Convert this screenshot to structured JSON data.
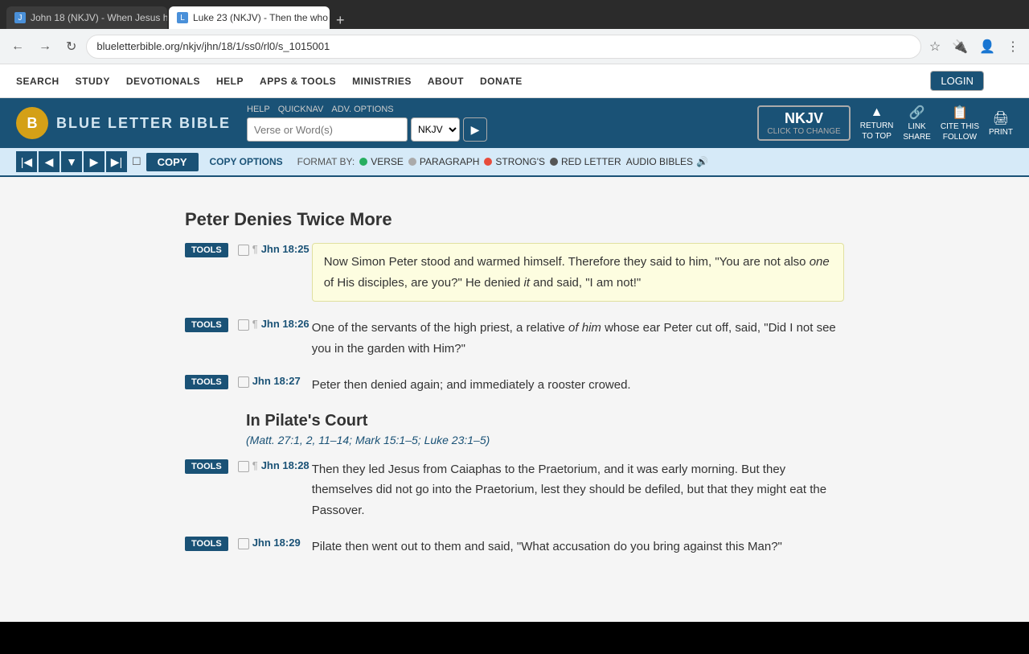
{
  "browser": {
    "tabs": [
      {
        "id": "tab1",
        "label": "John 18 (NKJV) - When Jesus h",
        "active": false,
        "favicon": "J"
      },
      {
        "id": "tab2",
        "label": "Luke 23 (NKJV) - Then the who",
        "active": true,
        "favicon": "L"
      }
    ],
    "url": "blueletterbible.org/nkjv/jhn/18/1/ss0/rl0/s_1015001",
    "new_tab_label": "+"
  },
  "nav": {
    "back": "←",
    "forward": "→",
    "reload": "↻"
  },
  "site": {
    "logo_letter": "B",
    "logo_text": "Blue Letter Bible",
    "search_placeholder": "Verse or Word(s)",
    "version": "NKJV",
    "version_click": "CLICK TO CHANGE",
    "nav_items": [
      "SEARCH",
      "STUDY",
      "DEVOTIONALS",
      "HELP",
      "APPS & TOOLS",
      "MINISTRIES",
      "ABOUT",
      "DONATE"
    ],
    "header_links": [
      {
        "label": "HELP",
        "id": "help"
      },
      {
        "label": "QUICKNAV",
        "id": "quicknav"
      },
      {
        "label": "ADV. OPTIONS",
        "id": "advoptions"
      }
    ],
    "header_actions": [
      {
        "icon": "▲",
        "line1": "RETURN",
        "line2": "TO TOP",
        "id": "return-top"
      },
      {
        "icon": "🔗",
        "line1": "LINK",
        "line2": "SHARE",
        "id": "link-share"
      },
      {
        "icon": "★",
        "line1": "CITE THIS",
        "line2": "FOLLOW",
        "id": "cite-follow"
      },
      {
        "icon": "🖨",
        "line1": "PRINT",
        "id": "print"
      }
    ],
    "login_label": "LOGIN",
    "version_badge": {
      "name": "NKJV",
      "sub": "CLICK TO CHANGE"
    }
  },
  "toolbar": {
    "copy_label": "COPY",
    "copy_options_label": "COPY OPTIONS",
    "format_by_label": "FORMAT BY:",
    "verse_label": "VERSE",
    "paragraph_label": "PARAGRAPH",
    "strongs_label": "STRONG'S",
    "red_letter_label": "RED LETTER",
    "audio_bibles_label": "AUDIO BIBLES"
  },
  "content": {
    "section_title": "Peter Denies Twice More",
    "verses": [
      {
        "id": "v18-25",
        "ref": "Jhn 18:25",
        "highlighted": true,
        "text": "Now Simon Peter stood and warmed himself. Therefore they said to him, \"You are not also ",
        "text_italic": "one",
        "text_after": " of His disciples, are you?\" He denied ",
        "text_italic2": "it",
        "text_end": " and said, \"I am not!\""
      },
      {
        "id": "v18-26",
        "ref": "Jhn 18:26",
        "highlighted": false,
        "text": "One of the servants of the high priest, a relative ",
        "text_italic": "of him",
        "text_after": " whose ear Peter cut off, said, \"Did I not see you in the garden with Him?\""
      },
      {
        "id": "v18-27",
        "ref": "Jhn 18:27",
        "highlighted": false,
        "text": "Peter then denied again; and immediately a rooster crowed."
      }
    ],
    "sub_section_title": "In Pilate's Court",
    "sub_section_refs": "(Matt. 27:1, 2, 11–14; Mark 15:1–5; Luke 23:1–5)",
    "verses2": [
      {
        "id": "v18-28",
        "ref": "Jhn 18:28",
        "text": "Then they led Jesus from Caiaphas to the Praetorium, and it was early morning. But they themselves did not go into the Praetorium, lest they should be defiled, but that they might eat the Passover."
      },
      {
        "id": "v18-29",
        "ref": "Jhn 18:29",
        "text": "Pilate then went out to them and said, \"What accusation do you bring against this Man?\""
      }
    ]
  }
}
